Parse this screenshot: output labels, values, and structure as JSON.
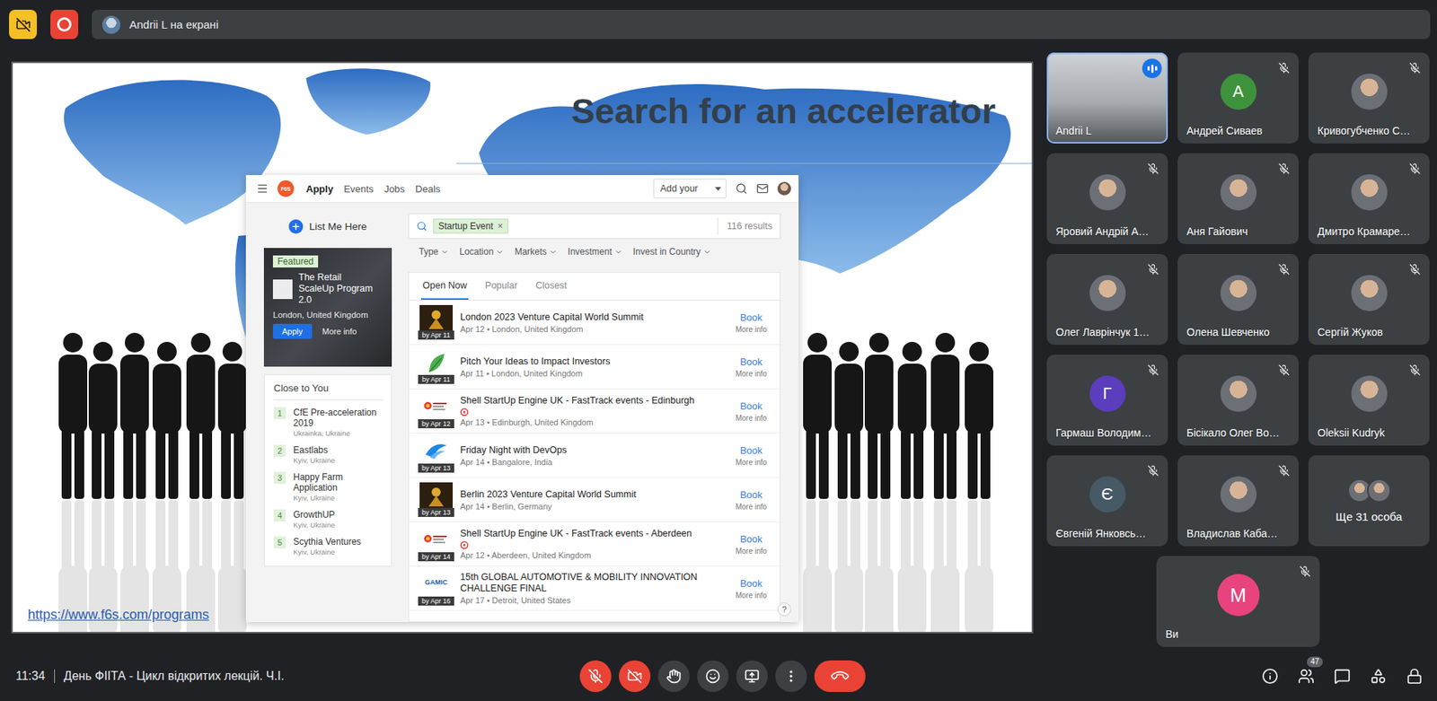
{
  "top_bar": {
    "recording": true,
    "presenter_label": "Andrii L на екрані"
  },
  "slide": {
    "title": "Search for an accelerator",
    "link": "https://www.f6s.com/programs",
    "browser": {
      "logo": "F6S",
      "nav": [
        {
          "label": "Apply",
          "selected": true
        },
        {
          "label": "Events",
          "selected": false
        },
        {
          "label": "Jobs",
          "selected": false
        },
        {
          "label": "Deals",
          "selected": false
        }
      ],
      "add_dropdown": "Add your",
      "list_me": "List Me Here",
      "featured": {
        "tag": "Featured",
        "title": "The Retail ScaleUp Program 2.0",
        "location": "London, United Kingdom",
        "apply": "Apply",
        "more": "More info"
      },
      "close_to_you": {
        "title": "Close to You",
        "items": [
          {
            "number": "1",
            "name": "CfE Pre-acceleration 2019",
            "location": "Ukrainka, Ukraine"
          },
          {
            "number": "2",
            "name": "Eastlabs",
            "location": "Kyiv, Ukraine"
          },
          {
            "number": "3",
            "name": "Happy Farm Application",
            "location": "Kyiv, Ukraine"
          },
          {
            "number": "4",
            "name": "GrowthUP",
            "location": "Kyiv, Ukraine"
          },
          {
            "number": "5",
            "name": "Scythia Ventures",
            "location": "Kyiv, Ukraine"
          }
        ]
      },
      "search": {
        "chip": "Startup Event",
        "chip_remove": "×",
        "results": "116 results"
      },
      "filters": [
        "Type",
        "Location",
        "Markets",
        "Investment",
        "Invest in Country"
      ],
      "tabs": [
        {
          "label": "Open Now",
          "selected": true
        },
        {
          "label": "Popular",
          "selected": false
        },
        {
          "label": "Closest",
          "selected": false
        }
      ],
      "events": [
        {
          "title": "London 2023 Venture Capital World Summit",
          "when": "Apr 12 • London, United Kingdom",
          "deadline": "by Apr 11",
          "thumb": "vc",
          "badge": false,
          "action": "Book",
          "more": "More info"
        },
        {
          "title": "Pitch Your Ideas to Impact Investors",
          "when": "Apr 11 • London, United Kingdom",
          "deadline": "by Apr 11",
          "thumb": "leaf",
          "badge": false,
          "action": "Book",
          "more": "More info"
        },
        {
          "title": "Shell StartUp Engine UK - FastTrack events - Edinburgh",
          "when": "Apr 13 • Edinburgh, United Kingdom",
          "deadline": "by Apr 12",
          "thumb": "shell",
          "badge": true,
          "action": "Book",
          "more": "More info"
        },
        {
          "title": "Friday Night with DevOps",
          "when": "Apr 14 • Bangalore, India",
          "deadline": "by Apr 13",
          "thumb": "devops",
          "badge": false,
          "action": "Book",
          "more": "More info"
        },
        {
          "title": "Berlin 2023 Venture Capital World Summit",
          "when": "Apr 14 • Berlin, Germany",
          "deadline": "by Apr 13",
          "thumb": "vc",
          "badge": false,
          "action": "Book",
          "more": "More info"
        },
        {
          "title": "Shell StartUp Engine UK - FastTrack events - Aberdeen",
          "when": "Apr 12 • Aberdeen, United Kingdom",
          "deadline": "by Apr 14",
          "thumb": "shell",
          "badge": true,
          "action": "Book",
          "more": "More info"
        },
        {
          "title": "15th GLOBAL AUTOMOTIVE & MOBILITY INNOVATION CHALLENGE FINAL",
          "when": "Apr 17 • Detroit, United States",
          "deadline": "by Apr 16",
          "thumb": "gamic",
          "logo_text": "GAMIC",
          "badge": false,
          "action": "Book",
          "more": "More info"
        }
      ],
      "help": "?"
    }
  },
  "participants": [
    {
      "name": "Andrii L",
      "kind": "video",
      "speaking": true,
      "muted": false
    },
    {
      "name": "Андрей Сиваев",
      "kind": "initial",
      "letter": "A",
      "color": "#3f923c",
      "speaking": false,
      "muted": true
    },
    {
      "name": "Кривогубченко С…",
      "kind": "photo",
      "speaking": false,
      "muted": true
    },
    {
      "name": "Яровий Андрій А…",
      "kind": "photo",
      "speaking": false,
      "muted": true
    },
    {
      "name": "Аня Гайович",
      "kind": "photo",
      "speaking": false,
      "muted": true
    },
    {
      "name": "Дмитро Крамаре…",
      "kind": "photo",
      "speaking": false,
      "muted": true
    },
    {
      "name": "Олег Лаврінчук 1…",
      "kind": "photo",
      "speaking": false,
      "muted": true
    },
    {
      "name": "Олена Шевченко",
      "kind": "photo",
      "speaking": false,
      "muted": true
    },
    {
      "name": "Сергій Жуков",
      "kind": "photo",
      "speaking": false,
      "muted": true
    },
    {
      "name": "Гармаш Володим…",
      "kind": "initial",
      "letter": "Г",
      "color": "#5b3dbd",
      "speaking": false,
      "muted": true
    },
    {
      "name": "Бісікало Олег Во…",
      "kind": "photo",
      "speaking": false,
      "muted": true
    },
    {
      "name": "Oleksii Kudryk",
      "kind": "photo",
      "speaking": false,
      "muted": true
    },
    {
      "name": "Євгеній Янковсь…",
      "kind": "initial",
      "letter": "Є",
      "color": "#455a64",
      "speaking": false,
      "muted": true
    },
    {
      "name": "Владислав Каба…",
      "kind": "photo",
      "speaking": false,
      "muted": true
    }
  ],
  "others": {
    "label": "Ще 31 особа"
  },
  "self": {
    "name": "Ви",
    "letter": "M",
    "color": "#e8437d",
    "muted": true
  },
  "bottom_bar": {
    "time": "11:34",
    "meeting_title": "День ФІІТА - Цикл відкритих лекцій. Ч.І.",
    "mic_on": false,
    "camera_on": false,
    "people_count": "47"
  }
}
